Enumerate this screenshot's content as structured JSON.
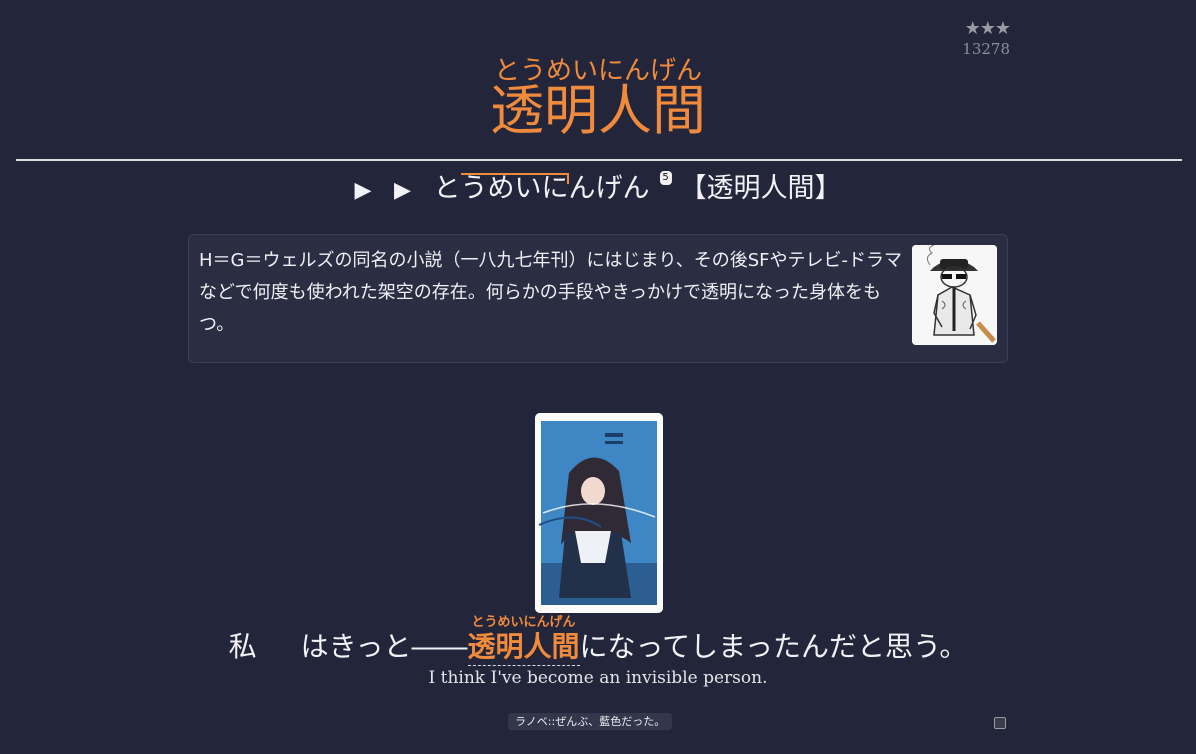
{
  "rating": {
    "stars": "★★★",
    "frequency": "13278"
  },
  "headword": {
    "reading": "とうめいにんげん",
    "expression": "透明人間"
  },
  "pitch": {
    "play_icon": "play-icon",
    "play_glyph": "▶",
    "reading_part1": "とうめいに",
    "reading_part2": "んげん",
    "accent_number": "5",
    "kanji_form": "【透明人間】"
  },
  "definition": {
    "text": "H＝G＝ウェルズの同名の小説（一八九七年刊）にはじまり、その後SFやテレビ‐ドラマなどで何度も使われた架空の存在。何らかの手段やきっかけで透明になった身体をもつ。",
    "image_icon": "invisible-man-sketch"
  },
  "example": {
    "sentence_start": "私",
    "sentence_before": "はきっと――",
    "highlight": "透明人間",
    "highlight_reading": "とうめいにんげん",
    "sentence_after": "になってしまったんだと思う。",
    "translation": "I think I've become an invisible person.",
    "cover_title": "ぜんぶ、藍色だった。",
    "source_tag": "ラノベ::ぜんぶ、藍色だった。"
  },
  "colors": {
    "background": "#23253a",
    "accent": "#f08a3c",
    "panel": "#2b2d42"
  }
}
